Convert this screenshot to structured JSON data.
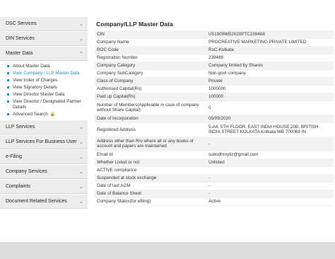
{
  "sidebar": {
    "top_items": [
      {
        "label": "DSC Services"
      },
      {
        "label": "DIN Services"
      },
      {
        "label": "Master Data"
      }
    ],
    "sub_items": [
      {
        "label": "About Master Data"
      },
      {
        "label": "View Company / LLP Master Data"
      },
      {
        "label": "View Index of Charges"
      },
      {
        "label": "View Signatory Details"
      },
      {
        "label": "View Director Master Data"
      },
      {
        "label": "View Director / Designated Partner Details"
      },
      {
        "label": "Advanced Search"
      }
    ],
    "bottom_items": [
      {
        "label": "LLP Services"
      },
      {
        "label": "LLP Services For Business User"
      },
      {
        "label": "e-Filing"
      },
      {
        "label": "Company Services"
      },
      {
        "label": "Complaints"
      },
      {
        "label": "Document Related Services"
      }
    ]
  },
  "main": {
    "title": "Company/LLP Master Data",
    "rows": [
      {
        "key": "CIN",
        "value": "U51909WB2020PTC239488"
      },
      {
        "key": "Company Name",
        "value": "PROCREATIVE MARKETING PRIVATE LIMITED"
      },
      {
        "key": "ROC Code",
        "value": "RoC-Kolkata"
      },
      {
        "key": "Registration Number",
        "value": "239488"
      },
      {
        "key": "Company Category",
        "value": "Company limited by Shares"
      },
      {
        "key": "Company SubCategory",
        "value": "Non-govt company"
      },
      {
        "key": "Class of Company",
        "value": "Private"
      },
      {
        "key": "Authorised Capital(Rs)",
        "value": "1000000"
      },
      {
        "key": "Paid up Capital(Rs)",
        "value": "100000"
      },
      {
        "key": "Number of Members(Applicable in case of company without Share Capital)",
        "value": "0"
      },
      {
        "key": "Date of Incorporation",
        "value": "05/09/2020"
      },
      {
        "key": "Registered Address",
        "value": "5-A4, 5TH FLOOR, EAST INDIA HOUSE 20B, BRITISH INDIA STREET KOLKATA Kolkata WB 700069 IN"
      },
      {
        "key": "Address other than R/o where all or any books of account and papers are maintained",
        "value": "-"
      },
      {
        "key": "Email Id",
        "value": "subodhroyliz@gmail.com"
      },
      {
        "key": "Whether Listed or not",
        "value": "Unlisted"
      },
      {
        "key": "ACTIVE compliance",
        "value": ""
      },
      {
        "key": "Suspended at stock exchange",
        "value": "-"
      },
      {
        "key": "Date of last AGM",
        "value": "-"
      },
      {
        "key": "Date of Balance Sheet",
        "value": "-"
      },
      {
        "key": "Company Status(for efiling)",
        "value": "Active"
      }
    ]
  }
}
